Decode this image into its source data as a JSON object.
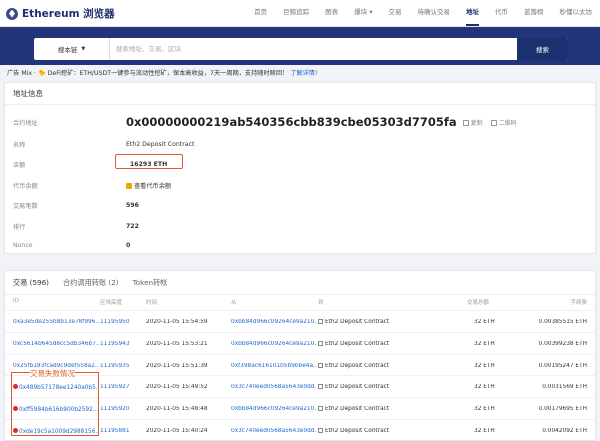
{
  "header": {
    "logo_text": "Ethereum 浏览器",
    "nav": [
      {
        "label": "首页",
        "active": false
      },
      {
        "label": "巨鲸追踪",
        "active": false
      },
      {
        "label": "图表",
        "active": false
      },
      {
        "label": "爆块 ▾",
        "active": false
      },
      {
        "label": "交易",
        "active": false
      },
      {
        "label": "待确认交易",
        "active": false
      },
      {
        "label": "地址",
        "active": true
      },
      {
        "label": "代币",
        "active": false
      },
      {
        "label": "蓝籌榜",
        "active": false
      },
      {
        "label": "秒懂以太坊",
        "active": false
      }
    ]
  },
  "search": {
    "select_label": "搜本链",
    "placeholder": "搜索地址、交易、区块",
    "button_label": "搜索"
  },
  "ad": {
    "text": "广告 Mix · 🐤 DeFi挖矿：ETH/USDT一键参与流动性挖矿，保本高收益，7天一周期，支持随时赎回！",
    "link": "了解详情!"
  },
  "address_info": {
    "title": "地址信息",
    "rows": {
      "address": {
        "label": "合约地址",
        "value": "0x00000000219ab540356cbb839cbe05303d7705fa"
      },
      "name": {
        "label": "名称",
        "value": "Eth2 Deposit Contract"
      },
      "balance": {
        "label": "余额",
        "value": "16293 ETH"
      },
      "token_balance": {
        "label": "代币余额",
        "value": "查看代币余额"
      },
      "tx_count": {
        "label": "交易笔数",
        "value": "596"
      },
      "rank": {
        "label": "排行",
        "value": "722"
      },
      "nonce": {
        "label": "Nonce",
        "value": "0"
      }
    },
    "copy_label": "复制",
    "qr_label": "二维码"
  },
  "transactions": {
    "tabs": [
      "交易 (596)",
      "合约调用转账 (2)",
      "Token转帐"
    ],
    "columns": {
      "id": "ID",
      "block": "区块高度",
      "time": "时间",
      "from": "从",
      "to": "到",
      "amount": "交易总额",
      "fee": "手续费"
    },
    "fail_annotation": "交易失败情况",
    "rows": [
      {
        "id": "0xa3e5de255b8b13e78f996...",
        "block": "11195950",
        "time": "2020-11-05 15:54:59",
        "from": "0xbb84d966c09264ce9a210...",
        "to": "Eth2 Deposit Contract",
        "amount": "32 ETH",
        "fee": "0.00385515 ETH",
        "failed": false
      },
      {
        "id": "0xc5614b645d8cc5db346b7...",
        "block": "11195943",
        "time": "2020-11-05 15:53:21",
        "from": "0xbb84d966c09264ce9a210...",
        "to": "Eth2 Deposit Contract",
        "amount": "32 ETH",
        "fee": "0.00399238 ETH",
        "failed": false
      },
      {
        "id": "0x25fb183fcad9c9def558a2...",
        "block": "11195935",
        "time": "2020-11-05 15:51:39",
        "from": "0xf398ac61610105b9bbe4a...",
        "to": "Eth2 Deposit Contract",
        "amount": "32 ETH",
        "fee": "0.00195247 ETH",
        "failed": false
      },
      {
        "id": "0x489b57178ee1240a0b5...",
        "block": "11195927",
        "time": "2020-11-05 15:49:52",
        "from": "0x3c740eed0568a5643e0dd...",
        "to": "Eth2 Deposit Contract",
        "amount": "32 ETH",
        "fee": "0.0031569 ETH",
        "failed": true
      },
      {
        "id": "0xff5984b616b900b2592...",
        "block": "11195920",
        "time": "2020-11-05 15:48:48",
        "from": "0xbb84d966c09264ce9a210...",
        "to": "Eth2 Deposit Contract",
        "amount": "32 ETH",
        "fee": "0.00179695 ETH",
        "failed": true
      },
      {
        "id": "0xde19c5a1009d2988156...",
        "block": "11195881",
        "time": "2020-11-05 15:40:24",
        "from": "0x3c740eed0568a5643e0dd...",
        "to": "Eth2 Deposit Contract",
        "amount": "32 ETH",
        "fee": "0.0042092 ETH",
        "failed": true
      }
    ]
  },
  "colors": {
    "brand": "#1c2f6e",
    "search_band": "#24347a",
    "link": "#1f66d2",
    "annotation": "#e05a2a",
    "error": "#d92b2b"
  }
}
